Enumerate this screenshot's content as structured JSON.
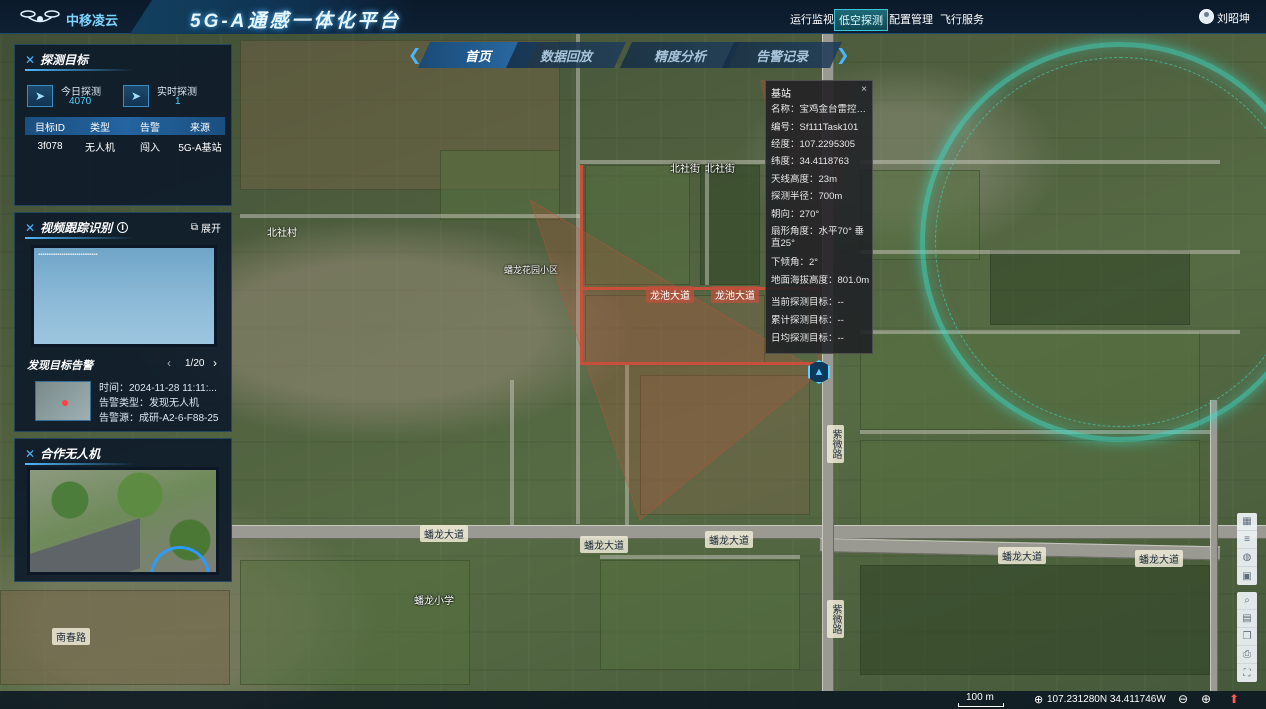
{
  "header": {
    "brand": "中移凌云",
    "title": "5G-A通感一体化平台",
    "nav": [
      "运行监视",
      "低空探测",
      "配置管理",
      "飞行服务"
    ],
    "active_nav": "低空探测",
    "user": "刘昭坤"
  },
  "tabs": [
    "首页",
    "数据回放",
    "精度分析",
    "告警记录"
  ],
  "active_tab": "首页",
  "detect_panel": {
    "title": "探测目标",
    "today_label": "今日探测",
    "today_value": "4070",
    "realtime_label": "实时探测",
    "realtime_value": "1",
    "columns": [
      "目标ID",
      "类型",
      "告警",
      "来源"
    ],
    "rows": [
      [
        "3f078",
        "无人机",
        "闯入",
        "5G-A基站"
      ]
    ]
  },
  "video_panel": {
    "title": "视频跟踪识别",
    "expand_label": "展开",
    "alarm_title": "发现目标告警",
    "pager": "1/20",
    "alarm_time": "时间：2024-11-28 11:11:...",
    "alarm_type": "告警类型：发现无人机",
    "alarm_source": "告警源：成研-A2-6-F88-25"
  },
  "drone_panel": {
    "title": "合作无人机"
  },
  "popup": {
    "title": "基站",
    "close": "×",
    "lines": [
      "名称：宝鸡金台雷控智...",
      "编号：Sf111Task101",
      "经度：107.2295305",
      "纬度：34.4118763",
      "天线高度：23m",
      "探测半径：700m",
      "朝向：270°",
      "扇形角度：水平70° 垂直25°",
      "下倾角：2°",
      "地面海拔高度：801.0m",
      "当前探测目标：--",
      "累计探测目标：--",
      "日均探测目标：--"
    ]
  },
  "map_labels": {
    "north_village": "北社村",
    "north_street": "北社街",
    "north_street2": "北社街",
    "longchi_road": "龙池大道",
    "longchi_road2": "龙池大道",
    "panlong_1": "蟠龙大道",
    "panlong_2": "蟠龙大道",
    "panlong_3": "蟠龙大道",
    "panlong_4": "蟠龙大道",
    "panlong_5": "蟠龙大道",
    "nanchun": "南春路",
    "ziwei": "紫微路",
    "ziwei2": "紫微路",
    "school": "蟠龙小学",
    "apartments": "蟠龙花园小区"
  },
  "bottom": {
    "scale": "100 m",
    "coords": "107.231280N 34.411746W"
  },
  "colors": {
    "accent": "#4fb8ff",
    "radar": "#3cdcc8",
    "sector": "#c8503a"
  }
}
